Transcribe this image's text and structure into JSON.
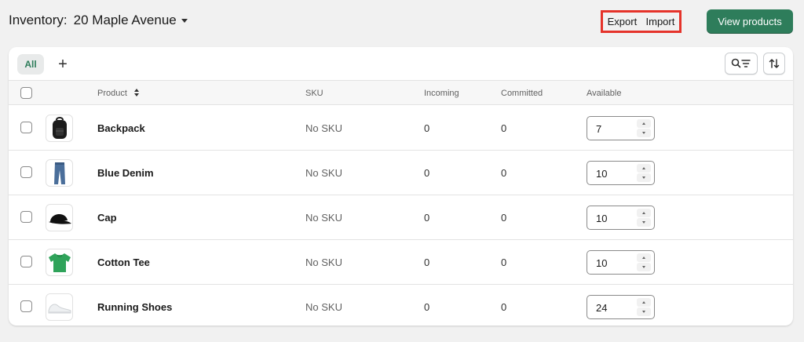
{
  "header": {
    "title_label": "Inventory:",
    "location": "20 Maple Avenue",
    "export_label": "Export",
    "import_label": "Import",
    "view_products_label": "View products"
  },
  "tabs": {
    "all_label": "All",
    "add_label": "+"
  },
  "table": {
    "columns": {
      "product": "Product",
      "sku": "SKU",
      "incoming": "Incoming",
      "committed": "Committed",
      "available": "Available"
    },
    "rows": [
      {
        "name": "Backpack",
        "sku": "No SKU",
        "incoming": "0",
        "committed": "0",
        "available": "7",
        "icon": "backpack-icon"
      },
      {
        "name": "Blue Denim",
        "sku": "No SKU",
        "incoming": "0",
        "committed": "0",
        "available": "10",
        "icon": "jeans-icon"
      },
      {
        "name": "Cap",
        "sku": "No SKU",
        "incoming": "0",
        "committed": "0",
        "available": "10",
        "icon": "cap-icon"
      },
      {
        "name": "Cotton Tee",
        "sku": "No SKU",
        "incoming": "0",
        "committed": "0",
        "available": "10",
        "icon": "tshirt-icon"
      },
      {
        "name": "Running Shoes",
        "sku": "No SKU",
        "incoming": "0",
        "committed": "0",
        "available": "24",
        "icon": "shoe-icon"
      }
    ]
  },
  "colors": {
    "primary_button": "#2e7d5b",
    "highlight_border": "#e5332a",
    "tab_active_text": "#2e7d5b",
    "tee_green": "#2fa35a"
  }
}
